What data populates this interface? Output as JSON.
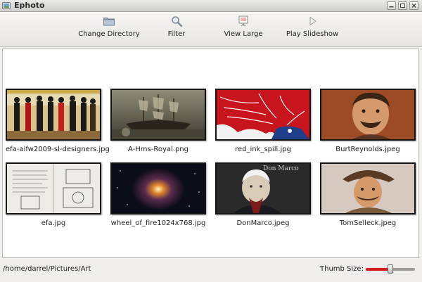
{
  "window": {
    "title": "Ephoto"
  },
  "toolbar": {
    "items": [
      {
        "label": "Change Directory",
        "icon": "folder-icon"
      },
      {
        "label": "Filter",
        "icon": "magnifier-icon"
      },
      {
        "label": "View Large",
        "icon": "presentation-icon"
      },
      {
        "label": "Play Slideshow",
        "icon": "play-icon"
      }
    ]
  },
  "thumbnails": [
    {
      "name": "efa-aifw2009-sl-designers.jpg"
    },
    {
      "name": "A-Hms-Royal.png"
    },
    {
      "name": "red_ink_spill.jpg"
    },
    {
      "name": "BurtReynolds.jpeg"
    },
    {
      "name": "efa.jpg"
    },
    {
      "name": "wheel_of_fire1024x768.jpg"
    },
    {
      "name": "DonMarco.jpeg",
      "caption": "Don Marco"
    },
    {
      "name": "TomSelleck.jpeg"
    }
  ],
  "status": {
    "path": "/home/darrel/Pictures/Art",
    "thumb_size_label": "Thumb Size:",
    "thumb_size_level": 0.5
  },
  "colors": {
    "slider_fill": "#d01c1c"
  }
}
